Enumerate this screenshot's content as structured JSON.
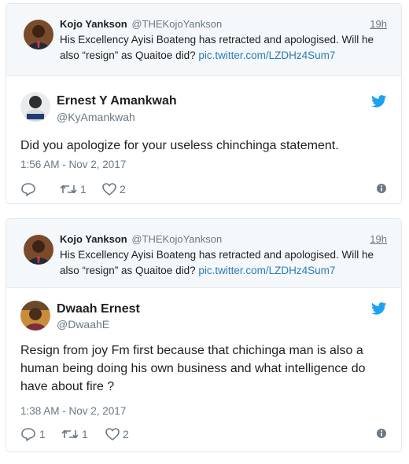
{
  "tweets": [
    {
      "quoted": {
        "name": "Kojo Yankson",
        "handle": "@THEKojoYankson",
        "time": "19h",
        "text": "His Excellency Ayisi Boateng has retracted and apologised. Will he also “resign” as Quaitoe did?",
        "link": "pic.twitter.com/LZDHz4Sum7"
      },
      "reply": {
        "name": "Ernest Y Amankwah",
        "handle": "@KyAmankwah",
        "text": "Did you apologize for your useless chinchinga statement.",
        "timestamp": "1:56 AM - Nov 2, 2017",
        "replies": "",
        "retweets": "1",
        "likes": "2"
      }
    },
    {
      "quoted": {
        "name": "Kojo Yankson",
        "handle": "@THEKojoYankson",
        "time": "19h",
        "text": "His Excellency Ayisi Boateng has retracted and apologised. Will he also “resign” as Quaitoe did?",
        "link": "pic.twitter.com/LZDHz4Sum7"
      },
      "reply": {
        "name": "Dwaah Ernest",
        "handle": "@DwaahE",
        "text": "Resign from joy Fm first because that chichinga man is also a human being doing his own business and what intelligence do have about fire ?",
        "timestamp": "1:38 AM - Nov 2, 2017",
        "replies": "1",
        "retweets": "1",
        "likes": "2"
      }
    }
  ],
  "icons": {
    "bird": "twitter-bird-icon",
    "reply": "reply-icon",
    "retweet": "retweet-icon",
    "like": "heart-icon",
    "info": "info-icon"
  },
  "colors": {
    "brand": "#1da1f2",
    "link": "#2b7bb9",
    "muted": "#697882",
    "text": "#1c2022",
    "quoted_bg": "#f5f8fa"
  }
}
